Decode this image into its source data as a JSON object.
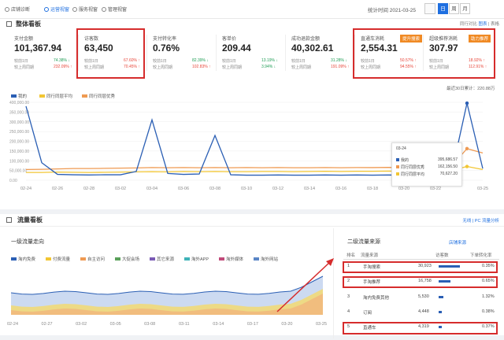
{
  "nav": {
    "tabs": [
      {
        "label": "店铺诊断",
        "icon": "location-icon"
      },
      {
        "label": "运营视窗",
        "icon": "shield-icon"
      },
      {
        "label": "服务视窗",
        "icon": "grid-icon"
      },
      {
        "label": "管理视窗",
        "icon": "grid-icon"
      }
    ],
    "stat_time": "统计时间 2021-03-25",
    "segments": [
      "日",
      "周",
      "月"
    ]
  },
  "overview": {
    "title": "整体看板",
    "toggle": {
      "label": "同行对比",
      "options": [
        "图表",
        "表格"
      ]
    },
    "metrics": [
      {
        "label": "支付金额",
        "value": "101,367.94",
        "cmp1_label": "较前1日",
        "cmp1": "74.38%",
        "cmp1_dir": "down",
        "cmp2_label": "较上周同期",
        "cmp2": "232.09%",
        "cmp2_dir": "up"
      },
      {
        "label": "访客数",
        "value": "63,450",
        "cmp1_label": "较前1日",
        "cmp1": "67.60%",
        "cmp1_dir": "up",
        "cmp2_label": "较上周同期",
        "cmp2": "70.45%",
        "cmp2_dir": "up"
      },
      {
        "label": "支付转化率",
        "value": "0.76%",
        "cmp1_label": "较前1日",
        "cmp1": "82.39%",
        "cmp1_dir": "down",
        "cmp2_label": "较上周同期",
        "cmp2": "102.83%",
        "cmp2_dir": "up"
      },
      {
        "label": "客单价",
        "value": "209.44",
        "cmp1_label": "较前1日",
        "cmp1": "13.19%",
        "cmp1_dir": "down",
        "cmp2_label": "较上周同期",
        "cmp2": "3.94%",
        "cmp2_dir": "down"
      },
      {
        "label": "成功退款金额",
        "value": "40,302.61",
        "cmp1_label": "较前1日",
        "cmp1": "31.28%",
        "cmp1_dir": "down",
        "cmp2_label": "较上周同期",
        "cmp2": "191.09%",
        "cmp2_dir": "up"
      },
      {
        "label": "直通车消耗",
        "value": "2,554.31",
        "badge": "提升搜索",
        "cmp1_label": "较前1日",
        "cmp1": "50.57%",
        "cmp1_dir": "up",
        "cmp2_label": "较上周同期",
        "cmp2": "94.55%",
        "cmp2_dir": "up"
      },
      {
        "label": "超级推荐消耗",
        "value": "307.97",
        "badge": "助力推荐",
        "cmp1_label": "较前1日",
        "cmp1": "18.92%",
        "cmp1_dir": "up",
        "cmp2_label": "较上周同期",
        "cmp2": "112.91%",
        "cmp2_dir": "up"
      }
    ],
    "recent_label": "最近30日累计：220.88万",
    "colors": {
      "mine": "#2b5fb4",
      "avg": "#f2c633",
      "best": "#ef9a52"
    }
  },
  "chart_data": {
    "type": "line",
    "x": [
      "02-24",
      "02-25",
      "02-26",
      "02-27",
      "02-28",
      "03-01",
      "03-02",
      "03-03",
      "03-04",
      "03-05",
      "03-06",
      "03-07",
      "03-08",
      "03-09",
      "03-10",
      "03-11",
      "03-12",
      "03-13",
      "03-14",
      "03-15",
      "03-16",
      "03-17",
      "03-18",
      "03-19",
      "03-20",
      "03-21",
      "03-22",
      "03-23",
      "03-24",
      "03-25"
    ],
    "xticks": [
      "02-24",
      "02-26",
      "02-28",
      "03-02",
      "03-04",
      "03-06",
      "03-08",
      "03-10",
      "03-12",
      "03-14",
      "03-16",
      "03-18",
      "03-20",
      "03-22",
      "03-25"
    ],
    "ylim": [
      0,
      400000
    ],
    "yticks": [
      "400,000.00",
      "350,000.00",
      "300,000.00",
      "250,000.00",
      "200,000.00",
      "150,000.00",
      "100,000.00",
      "50,000.00",
      "0.00"
    ],
    "series": [
      {
        "name": "我的",
        "values": [
          380000,
          90000,
          30000,
          28000,
          27000,
          28000,
          28000,
          45000,
          310000,
          35000,
          30000,
          32000,
          230000,
          28000,
          26000,
          26000,
          27000,
          26000,
          26000,
          27000,
          26000,
          27000,
          26000,
          27000,
          26000,
          27000,
          26000,
          28000,
          395686.57,
          60000
        ]
      },
      {
        "name": "同行同层平均",
        "values": [
          40000,
          40000,
          42000,
          41000,
          40000,
          41000,
          42000,
          43000,
          44000,
          43000,
          45000,
          44000,
          45000,
          44000,
          44000,
          45000,
          45000,
          44000,
          45000,
          46000,
          45000,
          46000,
          46000,
          47000,
          46000,
          47000,
          46000,
          50000,
          70627.2,
          55000
        ]
      },
      {
        "name": "同行同层优秀",
        "values": [
          55000,
          56000,
          58000,
          60000,
          60000,
          61000,
          62000,
          63000,
          65000,
          64000,
          65000,
          64000,
          65000,
          64000,
          65000,
          64000,
          65000,
          64000,
          64000,
          65000,
          64000,
          65000,
          65000,
          66000,
          64000,
          65000,
          64000,
          70000,
          162156.5,
          140000
        ]
      }
    ],
    "tooltip": {
      "date": "03-24",
      "rows": [
        {
          "name": "我的",
          "value": "395,686.57"
        },
        {
          "name": "同行同层优秀",
          "value": "162,156.50"
        },
        {
          "name": "同行同层平均",
          "value": "70,627.20"
        }
      ]
    }
  },
  "traffic": {
    "title": "流量看板",
    "toggle": {
      "label": "无线 | PC",
      "link": "流量分析"
    },
    "left_title": "一级流量走向",
    "legend": [
      {
        "name": "淘内免费",
        "color": "#2b5fb4"
      },
      {
        "name": "付费流量",
        "color": "#f2c633"
      },
      {
        "name": "自主访问",
        "color": "#ef9a52"
      },
      {
        "name": "大促会场",
        "color": "#5aa05a"
      },
      {
        "name": "其它来源",
        "color": "#7a5ab4"
      },
      {
        "name": "淘外APP",
        "color": "#3fb3b8"
      },
      {
        "name": "淘外媒体",
        "color": "#c14a7a"
      },
      {
        "name": "淘外网站",
        "color": "#5a86c6"
      }
    ],
    "xticks": [
      "02-24",
      "02-27",
      "03-02",
      "03-05",
      "03-08",
      "03-11",
      "03-14",
      "03-17",
      "03-20",
      "03-25"
    ],
    "right_title": "二级流量来源",
    "right_link": "店铺来源",
    "table": {
      "headers": [
        "排名",
        "流量来源",
        "访客数",
        "下单转化率"
      ],
      "rows": [
        {
          "rank": "1",
          "name": "手淘搜索",
          "visitors": "30,923",
          "bar": 0.95,
          "rate": "0.35%"
        },
        {
          "rank": "2",
          "name": "手淘推荐",
          "visitors": "16,758",
          "bar": 0.55,
          "rate": "0.65%"
        },
        {
          "rank": "3",
          "name": "淘内免费其他",
          "visitors": "5,530",
          "bar": 0.2,
          "rate": "1.32%"
        },
        {
          "rank": "4",
          "name": "订阅",
          "visitors": "4,448",
          "bar": 0.15,
          "rate": "0.38%"
        },
        {
          "rank": "5",
          "name": "直通车",
          "visitors": "4,319",
          "bar": 0.14,
          "rate": "0.37%"
        }
      ]
    }
  }
}
